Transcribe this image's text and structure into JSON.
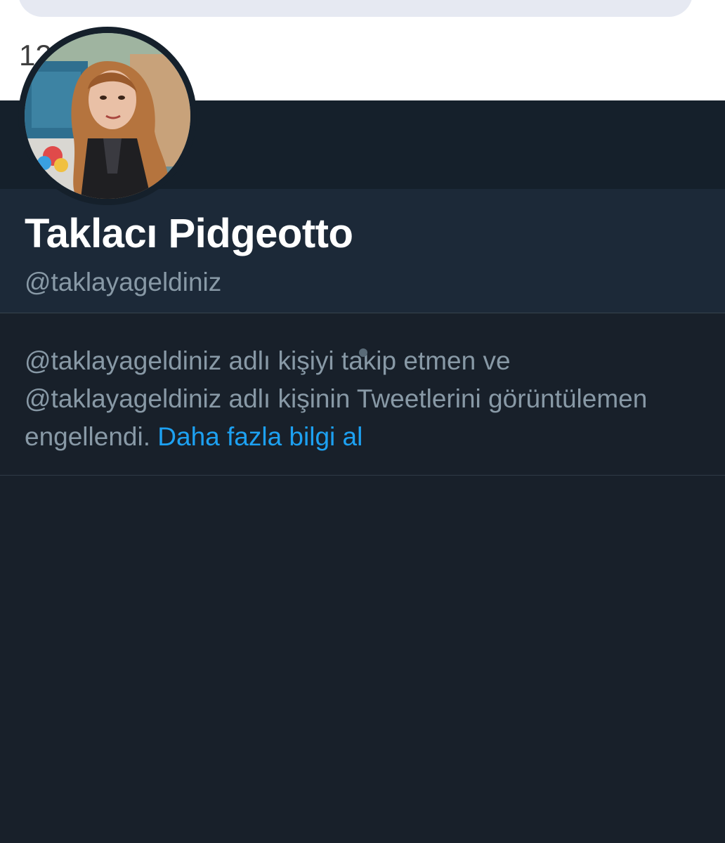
{
  "top": {
    "stub_text": "12"
  },
  "profile": {
    "display_name": "Taklacı Pidgeotto",
    "handle": "@taklayageldiniz",
    "avatar_icon": "profile-photo"
  },
  "notice": {
    "line1": "@taklayageldiniz adlı kişiyi takip etmen ve",
    "line2": "@taklayageldiniz adlı kişinin Tweetlerini görüntülemen",
    "line3": "engellendi.",
    "link": "Daha fazla bilgi al"
  },
  "colors": {
    "background": "#18202a",
    "panel": "#1c2938",
    "secondary_text": "#8899a6",
    "link": "#1da1f2"
  }
}
